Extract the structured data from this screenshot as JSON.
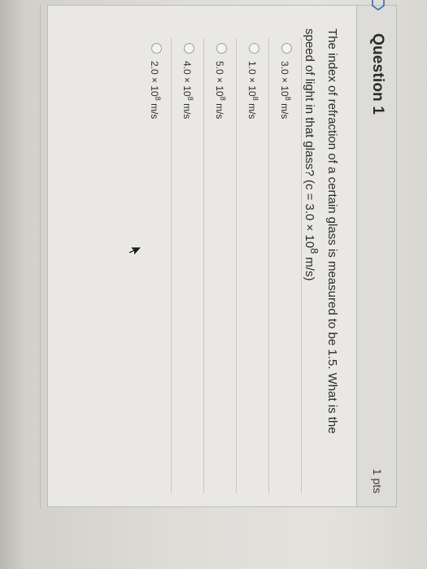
{
  "question": {
    "title": "Question 1",
    "points": "1 pts",
    "text_line1": "The index of refraction of a certain glass is measured to be 1.5. What is the",
    "text_line2_prefix": "speed of light in that glass? (c = 3.0 × 10",
    "text_line2_exp": "8",
    "text_line2_suffix": " m/s)"
  },
  "answers": [
    {
      "mantissa": "3.0 × 10",
      "exp": "8",
      "unit": " m/s"
    },
    {
      "mantissa": "1.0 × 10",
      "exp": "8",
      "unit": " m/s"
    },
    {
      "mantissa": "5.0 × 10",
      "exp": "8",
      "unit": " m/s"
    },
    {
      "mantissa": "4.0 × 10",
      "exp": "8",
      "unit": " m/s"
    },
    {
      "mantissa": "2.0 × 10",
      "exp": "8",
      "unit": " m/s"
    }
  ],
  "icons": {
    "bookmark": "bookmark-icon",
    "cursor": "mouse-pointer-icon"
  },
  "colors": {
    "card_border": "#b8bcc0",
    "bookmark": "#2f6fb3"
  }
}
